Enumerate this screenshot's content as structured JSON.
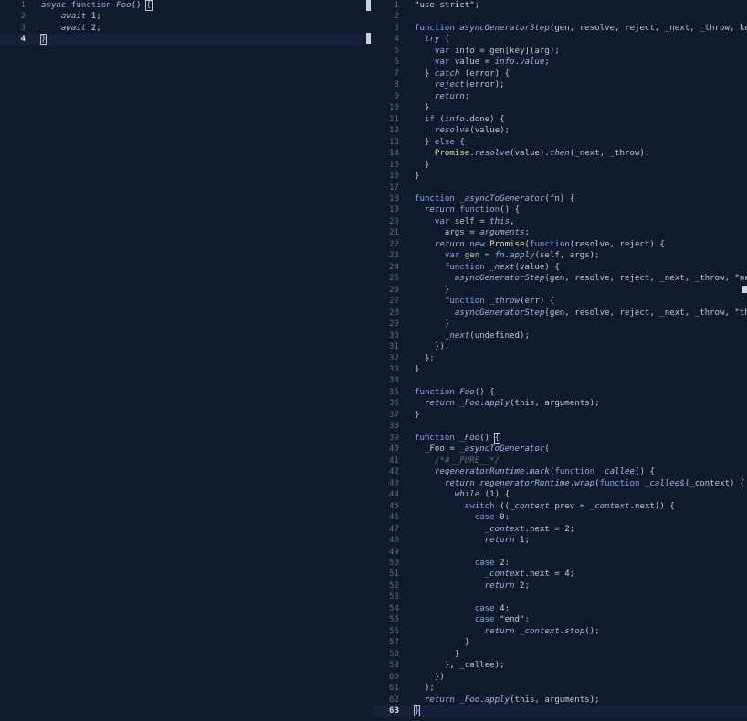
{
  "left_editor": {
    "lines": [
      {
        "n": "1",
        "html": "<span class=\"it kw\">async</span> <span class=\"kw\">function</span> <span class=\"fn\">Foo</span>() <span class=\"br-box\">{</span>"
      },
      {
        "n": "2",
        "html": "    <span class=\"it kw\">await</span> <span class=\"num\">1</span>;"
      },
      {
        "n": "3",
        "html": "    <span class=\"it kw\">await</span> <span class=\"num\">2</span>;"
      },
      {
        "n": "4",
        "html": "<span class=\"br-box\">}</span>",
        "active": true
      }
    ]
  },
  "right_editor": {
    "lines": [
      {
        "n": "1",
        "html": "<span class=\"str\">\"use strict\"</span>;"
      },
      {
        "n": "2",
        "html": ""
      },
      {
        "n": "3",
        "html": "<span class=\"kw\">function</span> <span class=\"fn\">asyncGeneratorStep</span>(gen, resolve, reject, _next, _throw, key, arg) {"
      },
      {
        "n": "4",
        "html": "  <span class=\"it kw\">try</span> {"
      },
      {
        "n": "5",
        "html": "    <span class=\"kw\">var</span> info = gen[key](arg);"
      },
      {
        "n": "6",
        "html": "    <span class=\"kw\">var</span> value = <span class=\"it\">info</span>.<span class=\"it\">value</span>;"
      },
      {
        "n": "7",
        "html": "  } <span class=\"it kw\">catch</span> (error) {"
      },
      {
        "n": "8",
        "html": "    <span class=\"it\">reject</span>(error);"
      },
      {
        "n": "9",
        "html": "    <span class=\"it kw\">return</span>;"
      },
      {
        "n": "10",
        "html": "  }"
      },
      {
        "n": "11",
        "html": "  <span class=\"kw\">if</span> (<span class=\"it\">info</span>.done) {"
      },
      {
        "n": "12",
        "html": "    <span class=\"it\">resolve</span>(value);"
      },
      {
        "n": "13",
        "html": "  } <span class=\"kw\">else</span> {"
      },
      {
        "n": "14",
        "html": "    <span class=\"cls\">Promise</span>.<span class=\"it\">resolve</span>(value).<span class=\"it\">then</span>(_next, _throw);"
      },
      {
        "n": "15",
        "html": "  }"
      },
      {
        "n": "16",
        "html": "}"
      },
      {
        "n": "17",
        "html": ""
      },
      {
        "n": "18",
        "html": "<span class=\"kw\">function</span> <span class=\"fn\">_asyncToGenerator</span>(fn) {"
      },
      {
        "n": "19",
        "html": "  <span class=\"it kw\">return</span> <span class=\"kw\">function</span>() {"
      },
      {
        "n": "20",
        "html": "    <span class=\"kw\">var</span> self = <span class=\"it\">this</span>,"
      },
      {
        "n": "21",
        "html": "      args = <span class=\"it\">arguments</span>;"
      },
      {
        "n": "22",
        "html": "    <span class=\"it kw\">return</span> <span class=\"kw\">new</span> <span class=\"cls\">Promise</span>(<span class=\"kw\">function</span>(resolve, reject) {"
      },
      {
        "n": "23",
        "html": "      <span class=\"kw\">var</span> gen = <span class=\"it\">fn</span>.<span class=\"it\">apply</span>(self, args);"
      },
      {
        "n": "24",
        "html": "      <span class=\"kw\">function</span> <span class=\"fn\">_next</span>(value) {"
      },
      {
        "n": "25",
        "html": "        <span class=\"it\">asyncGeneratorStep</span>(gen, resolve, reject, _next, _throw, <span class=\"str\">\"next\"</span>, value);"
      },
      {
        "n": "26",
        "html": "      }"
      },
      {
        "n": "27",
        "html": "      <span class=\"kw\">function</span> <span class=\"fn\">_throw</span>(err) {"
      },
      {
        "n": "28",
        "html": "        <span class=\"it\">asyncGeneratorStep</span>(gen, resolve, reject, _next, _throw, <span class=\"str\">\"throw\"</span>, err);"
      },
      {
        "n": "29",
        "html": "      }"
      },
      {
        "n": "30",
        "html": "      <span class=\"it\">_next</span>(undefined);"
      },
      {
        "n": "31",
        "html": "    });"
      },
      {
        "n": "32",
        "html": "  };"
      },
      {
        "n": "33",
        "html": "}"
      },
      {
        "n": "34",
        "html": ""
      },
      {
        "n": "35",
        "html": "<span class=\"kw\">function</span> <span class=\"fn\">Foo</span>() {"
      },
      {
        "n": "36",
        "html": "  <span class=\"it kw\">return</span> <span class=\"it\">_Foo</span>.<span class=\"it\">apply</span>(this, arguments);"
      },
      {
        "n": "37",
        "html": "}"
      },
      {
        "n": "38",
        "html": ""
      },
      {
        "n": "39",
        "html": "<span class=\"kw\">function</span> <span class=\"fn\">_Foo</span>() <span class=\"br-box\">{</span>"
      },
      {
        "n": "40",
        "html": "  _Foo = <span class=\"it\">_asyncToGenerator</span>("
      },
      {
        "n": "41",
        "html": "    <span class=\"cm\">/*#__PURE__*/</span>"
      },
      {
        "n": "42",
        "html": "    <span class=\"it\">regeneratorRuntime</span>.<span class=\"it\">mark</span>(<span class=\"kw\">function</span> <span class=\"fn\">_callee</span>() {"
      },
      {
        "n": "43",
        "html": "      <span class=\"it kw\">return</span> <span class=\"it\">regeneratorRuntime</span>.<span class=\"it\">wrap</span>(<span class=\"kw\">function</span> <span class=\"fn\">_callee$</span>(_context) {"
      },
      {
        "n": "44",
        "html": "        <span class=\"it kw\">while</span> (<span class=\"num\">1</span>) {"
      },
      {
        "n": "45",
        "html": "          <span class=\"kw\">switch</span> ((<span class=\"it\">_context</span>.prev = <span class=\"it\">_context</span>.next)) {"
      },
      {
        "n": "46",
        "html": "            <span class=\"kw\">case</span> <span class=\"num\">0</span>:"
      },
      {
        "n": "47",
        "html": "              <span class=\"it\">_context</span>.next = <span class=\"num\">2</span>;"
      },
      {
        "n": "48",
        "html": "              <span class=\"it kw\">return</span> <span class=\"num\">1</span>;"
      },
      {
        "n": "49",
        "html": ""
      },
      {
        "n": "50",
        "html": "            <span class=\"kw\">case</span> <span class=\"num\">2</span>:"
      },
      {
        "n": "51",
        "html": "              <span class=\"it\">_context</span>.next = <span class=\"num\">4</span>;"
      },
      {
        "n": "52",
        "html": "              <span class=\"it kw\">return</span> <span class=\"num\">2</span>;"
      },
      {
        "n": "53",
        "html": ""
      },
      {
        "n": "54",
        "html": "            <span class=\"kw\">case</span> <span class=\"num\">4</span>:"
      },
      {
        "n": "55",
        "html": "            <span class=\"kw\">case</span> <span class=\"str\">\"end\"</span>:"
      },
      {
        "n": "56",
        "html": "              <span class=\"it kw\">return</span> <span class=\"it\">_context</span>.<span class=\"it\">stop</span>();"
      },
      {
        "n": "57",
        "html": "          }"
      },
      {
        "n": "58",
        "html": "        }"
      },
      {
        "n": "59",
        "html": "      }, _callee);"
      },
      {
        "n": "60",
        "html": "    })"
      },
      {
        "n": "61",
        "html": "  );"
      },
      {
        "n": "62",
        "html": "  <span class=\"it kw\">return</span> <span class=\"it\">_Foo</span>.<span class=\"it\">apply</span>(this, arguments);"
      },
      {
        "n": "63",
        "html": "<span class=\"br-box\">}</span>",
        "active": true
      }
    ]
  }
}
